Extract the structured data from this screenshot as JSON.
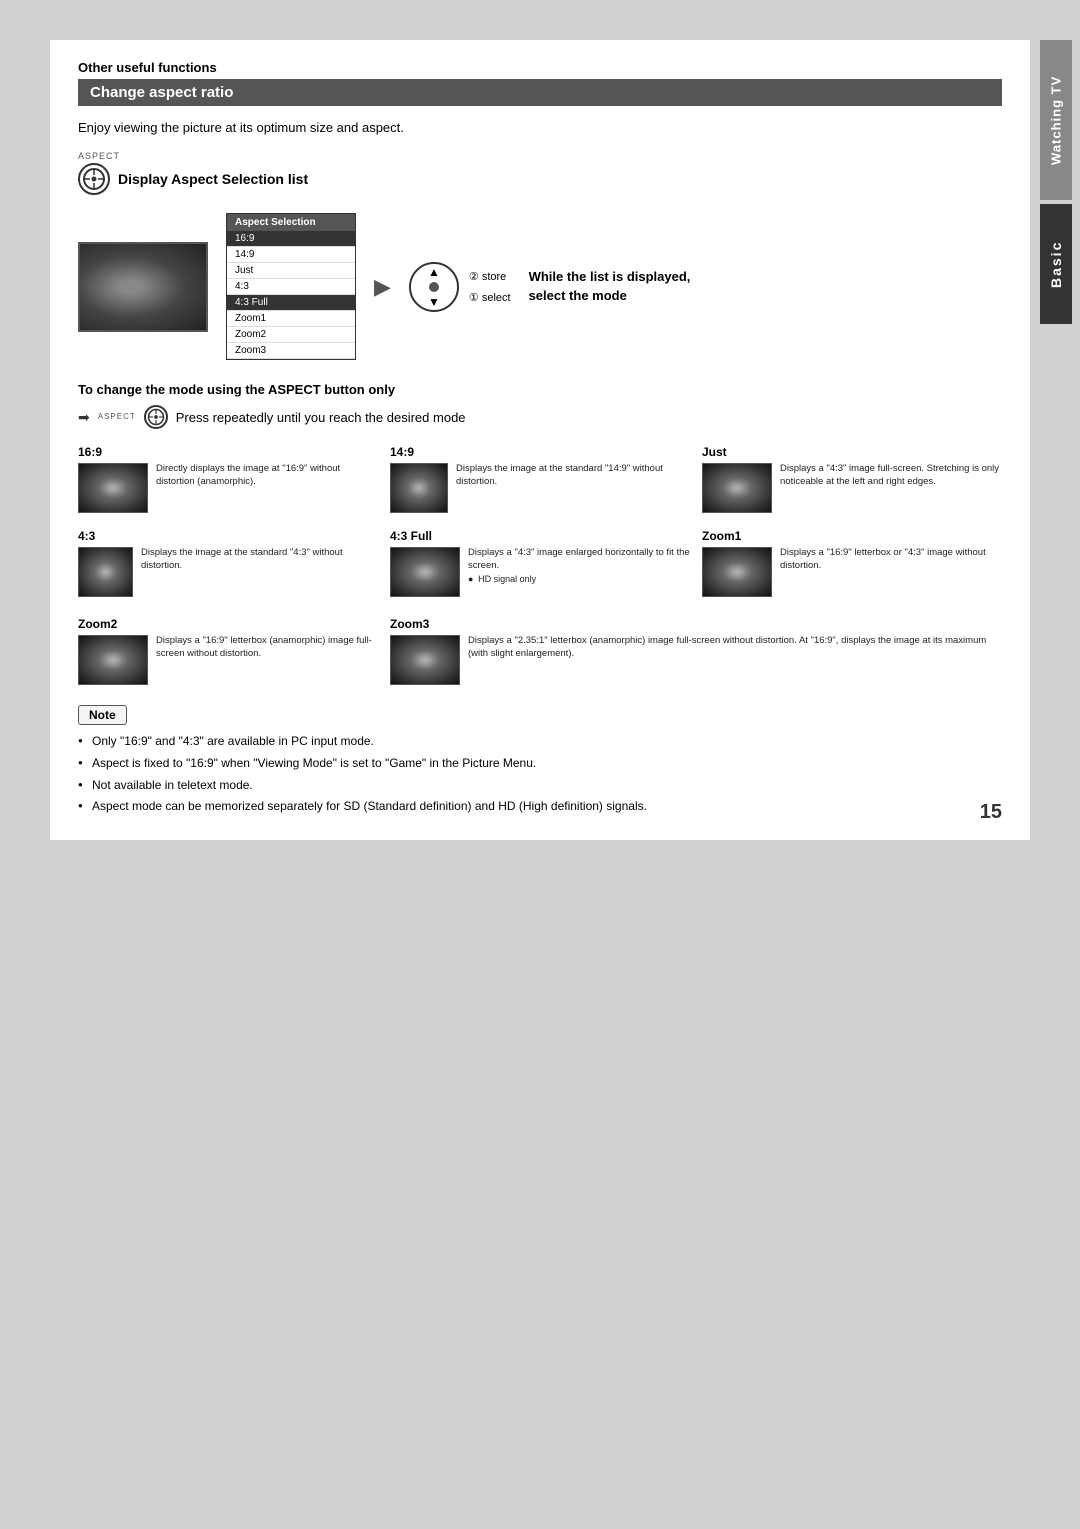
{
  "page": {
    "number": "15",
    "section": "Other useful functions",
    "title": "Change aspect ratio",
    "intro": "Enjoy viewing the picture at its optimum size and aspect.",
    "sidebar_watching": "Watching TV",
    "sidebar_basic": "Basic"
  },
  "aspect_section": {
    "label": "ASPECT",
    "button_title": "Display Aspect Selection list",
    "aspect_selection_header": "Aspect Selection",
    "aspect_items": [
      {
        "label": "16:9",
        "highlighted": true
      },
      {
        "label": "14:9",
        "highlighted": false
      },
      {
        "label": "Just",
        "highlighted": false
      },
      {
        "label": "4:3",
        "highlighted": false
      },
      {
        "label": "4:3 Full",
        "highlighted": true
      },
      {
        "label": "Zoom1",
        "highlighted": false
      },
      {
        "label": "Zoom2",
        "highlighted": false
      },
      {
        "label": "Zoom3",
        "highlighted": false
      }
    ],
    "store_label": "② store",
    "select_label": "① select",
    "while_list_text": "While the list is displayed,\nselect the mode"
  },
  "change_mode": {
    "title": "To change the mode using the ASPECT button only",
    "aspect_label": "ASPECT",
    "press_text": "Press repeatedly until you reach the desired mode"
  },
  "modes": [
    {
      "label": "16:9",
      "desc": "Directly displays the image at \"16:9\" without distortion (anamorphic)."
    },
    {
      "label": "14:9",
      "desc": "Displays the image at the standard \"14:9\" without distortion."
    },
    {
      "label": "Just",
      "desc": "Displays a \"4:3\" image full-screen. Stretching is only noticeable at the left and right edges."
    },
    {
      "label": "4:3",
      "desc": "Displays the image at the standard \"4:3\" without distortion."
    },
    {
      "label": "4:3 Full",
      "desc": "Displays a \"4:3\" image enlarged horizontally to fit the screen.\n● HD signal only"
    },
    {
      "label": "Zoom1",
      "desc": "Displays a \"16:9\" letterbox or \"4:3\" image without distortion."
    },
    {
      "label": "Zoom2",
      "desc": "Displays a \"16:9\" letterbox (anamorphic) image full-screen without distortion."
    },
    {
      "label": "Zoom3",
      "desc": "Displays a \"2.35:1\" letterbox (anamorphic) image full-screen without distortion. At \"16:9\", displays the image at its maximum (with slight enlargement)."
    }
  ],
  "notes": {
    "label": "Note",
    "items": [
      "Only \"16:9\" and \"4:3\" are available in PC input mode.",
      "Aspect is fixed to \"16:9\" when \"Viewing Mode\" is set to \"Game\" in the Picture Menu.",
      "Not available in teletext mode.",
      "Aspect mode can be memorized separately for SD (Standard definition) and HD (High definition) signals."
    ]
  }
}
